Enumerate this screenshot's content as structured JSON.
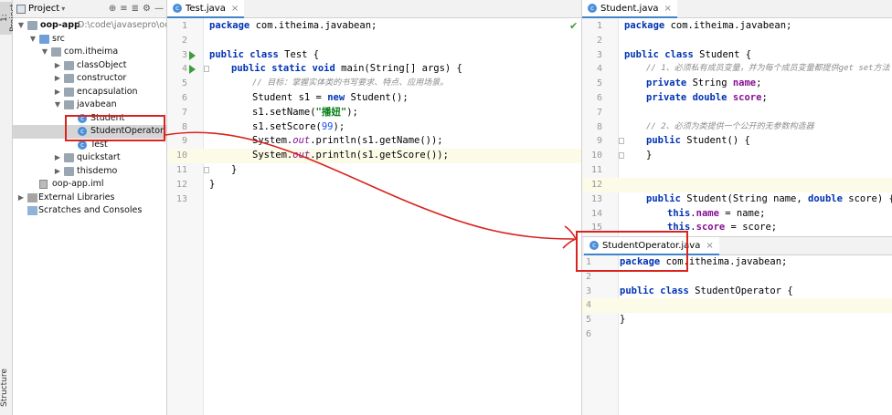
{
  "left_strip": {
    "project_tab": "1: Project",
    "structure_tab": "Structure"
  },
  "project_panel": {
    "header_label": "Project",
    "tree": [
      {
        "label": "oop-app",
        "path": "D:\\code\\javasepro\\oop"
      },
      {
        "label": "src"
      },
      {
        "label": "com.itheima"
      },
      {
        "label": "classObject"
      },
      {
        "label": "constructor"
      },
      {
        "label": "encapsulation"
      },
      {
        "label": "javabean"
      },
      {
        "label": "Student"
      },
      {
        "label": "StudentOperator"
      },
      {
        "label": "Test"
      },
      {
        "label": "quickstart"
      },
      {
        "label": "thisdemo"
      },
      {
        "label": "oop-app.iml"
      },
      {
        "label": "External Libraries"
      },
      {
        "label": "Scratches and Consoles"
      }
    ]
  },
  "tabs": {
    "test": "Test.java",
    "student": "Student.java",
    "operator": "StudentOperator.java",
    "close": "×"
  },
  "colors": {
    "annotation": "#d9231f",
    "selection": "#d5d5d5",
    "accent": "#4083c9"
  },
  "test_editor": {
    "line_numbers": [
      "1",
      "2",
      "3",
      "4",
      "5",
      "6",
      "7",
      "8",
      "9",
      "10",
      "11",
      "12",
      "13"
    ],
    "code": {
      "l1_kw": "package",
      "l1_rest": " com.itheima.javabean;",
      "l3_kw": "public class",
      "l3_rest": " Test {",
      "l4_kw": "public static void",
      "l4_rest": " main(String[] args) {",
      "l5_comment": "// 目标：掌握实体类的书写要求、特点、应用场景。",
      "l6_a": "Student s1 = ",
      "l6_kw": "new",
      "l6_b": " Student();",
      "l7_a": "s1.setName(",
      "l7_str": "\"播妞\"",
      "l7_b": ");",
      "l8_a": "s1.setScore(",
      "l8_num": "99",
      "l8_b": ");",
      "l9_a": "System.",
      "l9_out": "out",
      "l9_b": ".println(s1.getName());",
      "l10_a": "System.",
      "l10_out": "out",
      "l10_b": ".println(s1.getScore());",
      "l11": "}",
      "l12": "}"
    }
  },
  "student_editor": {
    "line_numbers": [
      "1",
      "2",
      "3",
      "4",
      "5",
      "6",
      "7",
      "8",
      "9",
      "10",
      "11",
      "12",
      "13",
      "14",
      "15"
    ],
    "code": {
      "l1_kw": "package",
      "l1_rest": " com.itheima.javabean;",
      "l3_kw": "public class",
      "l3_rest": " Student {",
      "l4_comment": "// 1、必须私有成员变量，并为每个成员变量都提供get set方法",
      "l5_kw": "private",
      "l5_rest": " String ",
      "l5_fld": "name",
      "l5_end": ";",
      "l6_kw": "private double",
      "l6_fld": " score",
      "l6_end": ";",
      "l8_comment": "// 2、必须为类提供一个公开的无参数构造器",
      "l9_kw": "public",
      "l9_rest": " Student() {",
      "l10": "}",
      "l13_kw": "public",
      "l13_a": " Student(String name, ",
      "l13_kw2": "double",
      "l13_b": " score) {",
      "l14_kw": "this",
      "l14_a": ".",
      "l14_fld": "name",
      "l14_b": " = name;",
      "l15_kw": "this",
      "l15_a": ".",
      "l15_fld": "score",
      "l15_b": " = score;"
    }
  },
  "operator_editor": {
    "line_numbers": [
      "1",
      "2",
      "3",
      "4",
      "5",
      "6"
    ],
    "code": {
      "l1_kw": "package",
      "l1_rest": " com.itheima.javabean;",
      "l3_kw": "public class",
      "l3_rest": " StudentOperator {",
      "l5": "}"
    }
  }
}
